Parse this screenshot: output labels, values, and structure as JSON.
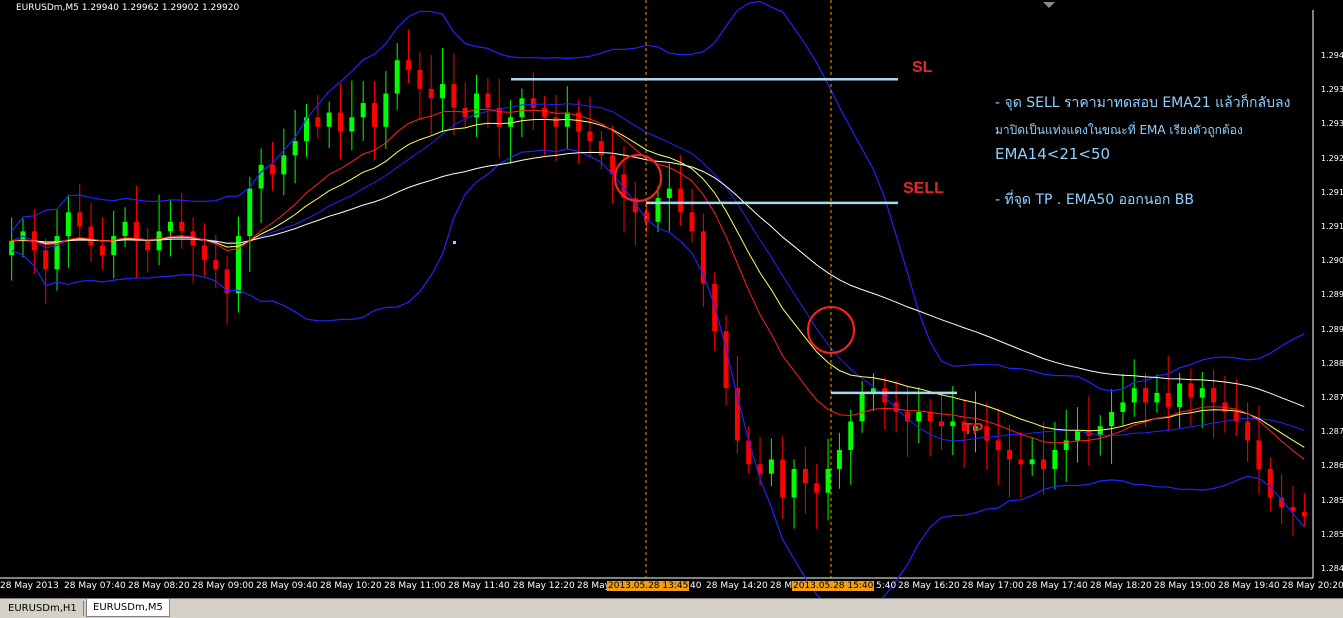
{
  "header": {
    "symbol_info": "EURUSDm,M5  1.29940 1.29962 1.29902 1.29920"
  },
  "annotations": {
    "sl_label": "SL",
    "sell_label": "SELL",
    "tp_label": "TP",
    "note_line1": "- จุด SELL ราคามาทดสอบ EMA21 แล้วก็กลับลง",
    "note_line2": "มาปิดเป็นแท่งแดงในขณะที่ EMA เรียงตัวถูกต้อง",
    "note_line3": "EMA14<21<50",
    "note_line4": "- ที่จุด TP . EMA50 ออกนอก BB"
  },
  "y_axis_ticks": [
    "1.294",
    "1.293",
    "1.293",
    "1.292",
    "1.291",
    "1.291",
    "1.290",
    "1.289",
    "1.289",
    "1.288",
    "1.287",
    "1.287",
    "1.286",
    "1.285",
    "1.285",
    "1.284"
  ],
  "x_axis_ticks": [
    "28 May 2013",
    "28 May 07:40",
    "28 May 08:20",
    "28 May 09:00",
    "28 May 09:40",
    "28 May 10:20",
    "28 May 11:00",
    "28 May 11:40",
    "28 May 12:20",
    "28 May",
    "40",
    "28 May 14:20",
    "28 May",
    "5:40",
    "28 May 16:20",
    "28 May 17:00",
    "28 May 17:40",
    "28 May 18:20",
    "28 May 19:00",
    "28 May 19:40",
    "28 May 20:20"
  ],
  "x_axis_highlights": [
    "2013.05.28 13:45",
    "2013.05.28 15:40"
  ],
  "tabs": [
    {
      "label": "EURUSDm,H1"
    },
    {
      "label": "EURUSDm,M5"
    }
  ],
  "colors": {
    "bull": "#00ff00",
    "bear": "#ff0000",
    "bb": "#2222ff",
    "ema14": "#ff2020",
    "ema21": "#ffff66",
    "ema50": "#fffff0",
    "levels": "#a8d8f0",
    "vline": "#f39c12",
    "circle": "#ff2020"
  },
  "chart_data": {
    "type": "candlestick",
    "symbol": "EURUSDm",
    "timeframe": "M5",
    "ylim": [
      1.284,
      1.2945
    ],
    "indicators": [
      "Bollinger Bands",
      "EMA14",
      "EMA21",
      "EMA50"
    ],
    "levels": [
      {
        "name": "SL",
        "price": 1.2938
      },
      {
        "name": "SELL",
        "price": 1.2912
      },
      {
        "name": "TP",
        "price": 1.2872
      }
    ],
    "close_path": [
      1.2904,
      1.2906,
      1.2902,
      1.2898,
      1.2905,
      1.291,
      1.2907,
      1.2903,
      1.2901,
      1.2905,
      1.2908,
      1.2904,
      1.2902,
      1.2906,
      1.2908,
      1.2906,
      1.2903,
      1.29,
      1.2898,
      1.2893,
      1.2905,
      1.2915,
      1.292,
      1.2918,
      1.2922,
      1.2925,
      1.293,
      1.2928,
      1.2931,
      1.2927,
      1.293,
      1.2933,
      1.2928,
      1.2935,
      1.2942,
      1.294,
      1.2936,
      1.2934,
      1.2937,
      1.2932,
      1.293,
      1.2935,
      1.2932,
      1.2928,
      1.293,
      1.2934,
      1.2932,
      1.293,
      1.2928,
      1.2931,
      1.2927,
      1.2925,
      1.2922,
      1.2918,
      1.2913,
      1.291,
      1.2908,
      1.2913,
      1.2915,
      1.291,
      1.2906,
      1.2895,
      1.2885,
      1.2873,
      1.2862,
      1.2857,
      1.2855,
      1.2858,
      1.285,
      1.2856,
      1.2853,
      1.2851,
      1.2856,
      1.286,
      1.2866,
      1.2872,
      1.2873,
      1.287,
      1.2868,
      1.2866,
      1.2868,
      1.2866,
      1.2865,
      1.2866,
      1.2864,
      1.2865,
      1.2862,
      1.286,
      1.2858,
      1.2857,
      1.2858,
      1.2856,
      1.286,
      1.2862,
      1.2864,
      1.2863,
      1.2865,
      1.2868,
      1.287,
      1.2873,
      1.287,
      1.2872,
      1.2869,
      1.2874,
      1.2871,
      1.2873,
      1.287,
      1.2868,
      1.2866,
      1.2862,
      1.2856,
      1.285,
      1.2848,
      1.2847,
      1.2846
    ]
  }
}
